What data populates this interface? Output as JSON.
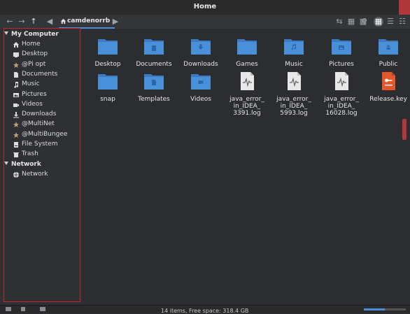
{
  "window": {
    "title": "Home"
  },
  "toolbar": {
    "path_segment": "camdenorrb"
  },
  "sidebar": {
    "sections": [
      {
        "title": "My Computer",
        "items": [
          {
            "label": "Home",
            "icon": "home-icon"
          },
          {
            "label": "Desktop",
            "icon": "desktop-icon"
          },
          {
            "label": "@Pi opt",
            "icon": "star-icon"
          },
          {
            "label": "Documents",
            "icon": "document-icon"
          },
          {
            "label": "Music",
            "icon": "music-icon"
          },
          {
            "label": "Pictures",
            "icon": "picture-icon"
          },
          {
            "label": "Videos",
            "icon": "video-icon"
          },
          {
            "label": "Downloads",
            "icon": "download-icon"
          },
          {
            "label": "@MultiNet",
            "icon": "star-icon"
          },
          {
            "label": "@MultiBungee",
            "icon": "star-icon"
          },
          {
            "label": "File System",
            "icon": "drive-icon"
          },
          {
            "label": "Trash",
            "icon": "trash-icon"
          }
        ]
      },
      {
        "title": "Network",
        "items": [
          {
            "label": "Network",
            "icon": "network-icon"
          }
        ]
      }
    ]
  },
  "files": [
    {
      "label": "Desktop",
      "type": "folder"
    },
    {
      "label": "Documents",
      "type": "folder"
    },
    {
      "label": "Downloads",
      "type": "folder"
    },
    {
      "label": "Games",
      "type": "folder"
    },
    {
      "label": "Music",
      "type": "folder"
    },
    {
      "label": "Pictures",
      "type": "folder"
    },
    {
      "label": "Public",
      "type": "folder"
    },
    {
      "label": "snap",
      "type": "folder"
    },
    {
      "label": "Templates",
      "type": "folder"
    },
    {
      "label": "Videos",
      "type": "folder"
    },
    {
      "label": "java_error_\nin_IDEA_\n3391.log",
      "type": "log"
    },
    {
      "label": "java_error_\nin_IDEA_\n5993.log",
      "type": "log"
    },
    {
      "label": "java_error_\nin_IDEA_\n16028.log",
      "type": "log"
    },
    {
      "label": "Release.key",
      "type": "key"
    }
  ],
  "status": {
    "text": "14 items, Free space: 318.4 GB"
  },
  "colors": {
    "folder": "#4a90d9",
    "selection": "#c0272d",
    "key_file": "#e2572b"
  }
}
